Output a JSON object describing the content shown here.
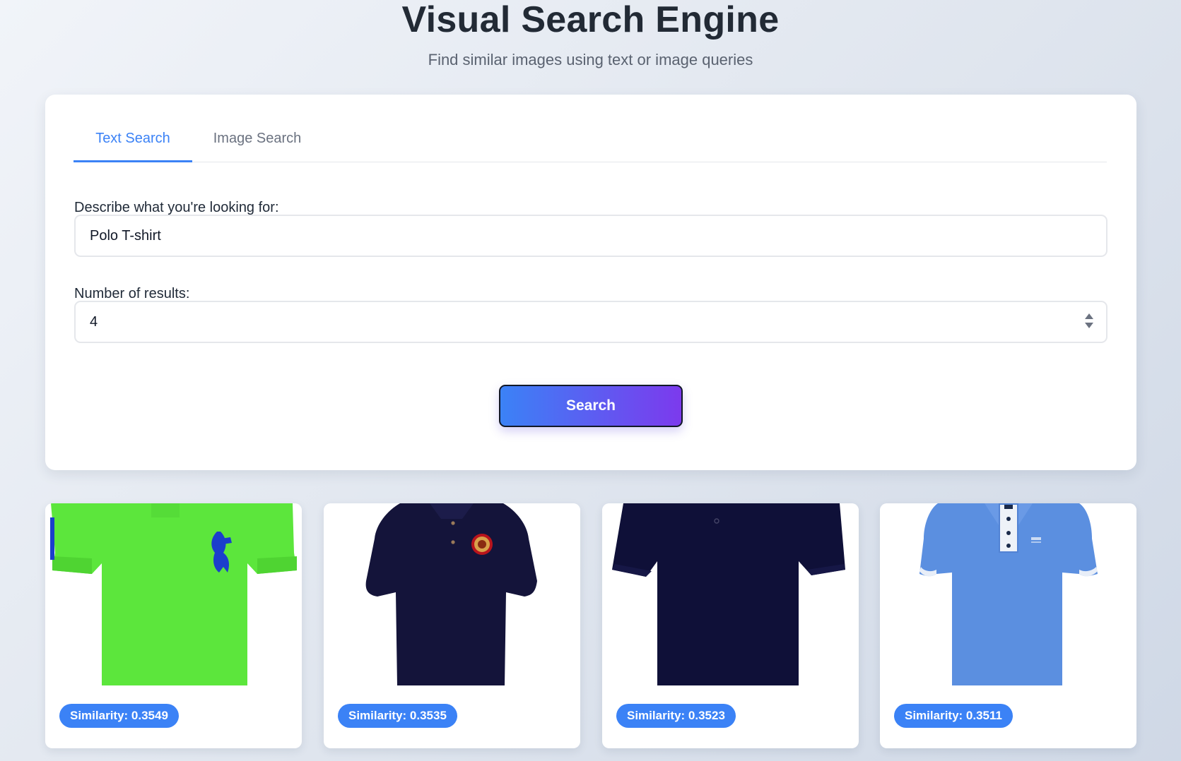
{
  "header": {
    "title": "Visual Search Engine",
    "subtitle": "Find similar images using text or image queries"
  },
  "tabs": [
    {
      "label": "Text Search",
      "active": true
    },
    {
      "label": "Image Search",
      "active": false
    }
  ],
  "form": {
    "query_label": "Describe what you're looking for:",
    "query_value": "Polo T-shirt",
    "count_label": "Number of results:",
    "count_value": "4",
    "search_label": "Search"
  },
  "results": [
    {
      "similarity": "Similarity: 0.3549",
      "image": "green-polo-shirt",
      "color": "#5ce63c"
    },
    {
      "similarity": "Similarity: 0.3535",
      "image": "navy-polo-with-emblem",
      "color": "#14143a"
    },
    {
      "similarity": "Similarity: 0.3523",
      "image": "navy-polo-shirt",
      "color": "#0f1038"
    },
    {
      "similarity": "Similarity: 0.3511",
      "image": "blue-polo-shirt",
      "color": "#5b8fe0"
    }
  ],
  "colors": {
    "accent": "#3b82f6",
    "gradient_end": "#7c3aed"
  }
}
